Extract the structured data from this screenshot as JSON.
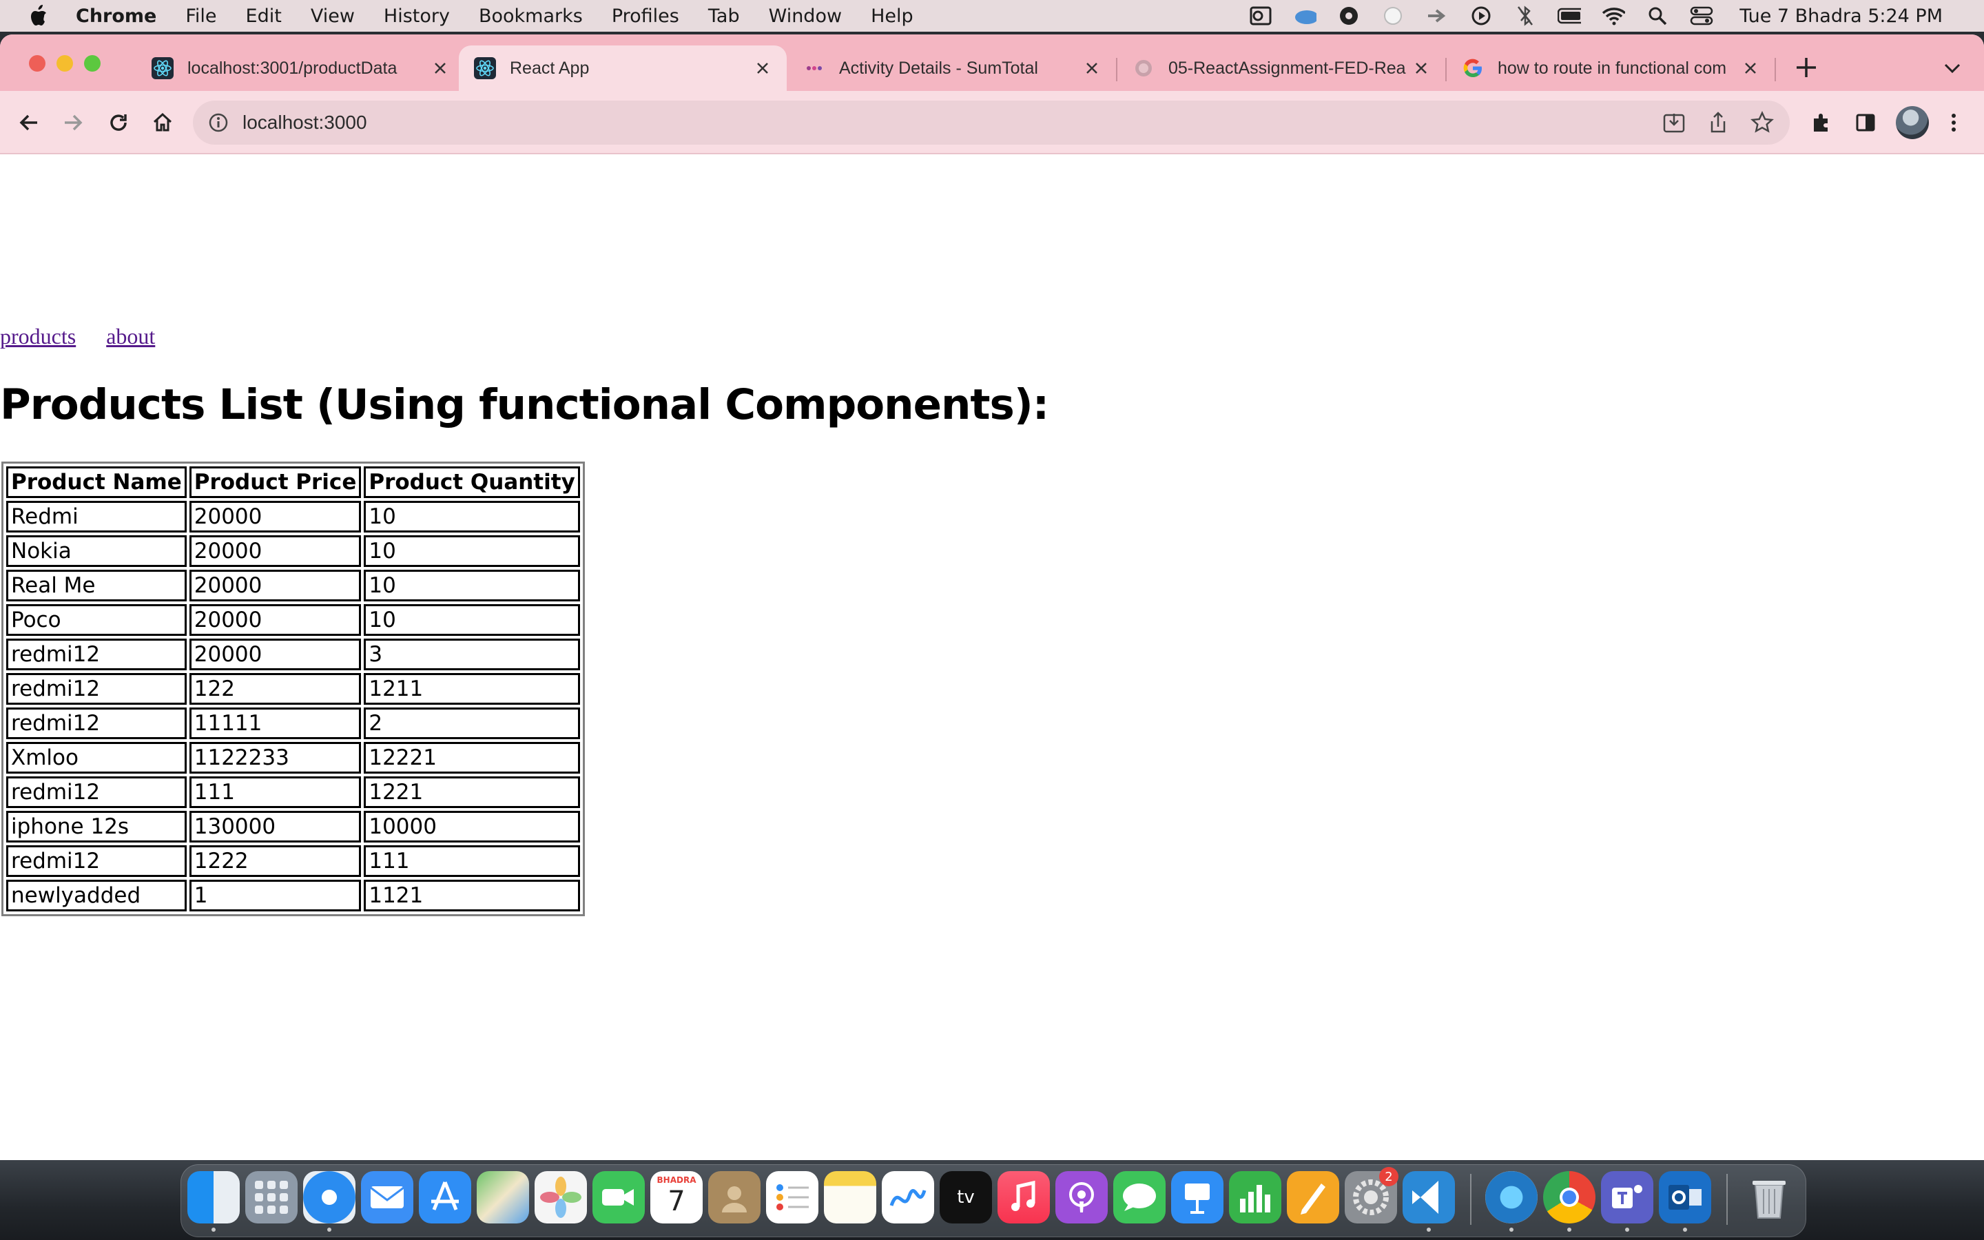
{
  "menubar": {
    "app_name": "Chrome",
    "menus": [
      "File",
      "Edit",
      "View",
      "History",
      "Bookmarks",
      "Profiles",
      "Tab",
      "Window",
      "Help"
    ],
    "clock": "Tue 7 Bhadra  5:24 PM"
  },
  "browser": {
    "tabs": [
      {
        "title": "localhost:3001/productData",
        "icon": "react-icon"
      },
      {
        "title": "React App",
        "icon": "react-icon",
        "active": true
      },
      {
        "title": "Activity Details - SumTotal",
        "icon": "wipro-icon"
      },
      {
        "title": "05-ReactAssignment-FED-Rea",
        "icon": "globe-icon"
      },
      {
        "title": "how to route in functional com",
        "icon": "google-icon"
      }
    ],
    "url": "localhost:3000"
  },
  "page": {
    "nav": {
      "products": "products",
      "about": "about"
    },
    "heading": "Products List (Using functional Components):",
    "table": {
      "headers": [
        "Product Name",
        "Product Price",
        "Product Quantity"
      ],
      "rows": [
        [
          "Redmi",
          "20000",
          "10"
        ],
        [
          "Nokia",
          "20000",
          "10"
        ],
        [
          "Real Me",
          "20000",
          "10"
        ],
        [
          "Poco",
          "20000",
          "10"
        ],
        [
          "redmi12",
          "20000",
          "3"
        ],
        [
          "redmi12",
          "122",
          "1211"
        ],
        [
          "redmi12",
          "11111",
          "2"
        ],
        [
          "Xmloo",
          "1122233",
          "12221"
        ],
        [
          "redmi12",
          "111",
          "1221"
        ],
        [
          "iphone 12s",
          "130000",
          "10000"
        ],
        [
          "redmi12",
          "1222",
          "111"
        ],
        [
          "newlyadded",
          "1",
          "1121"
        ]
      ]
    }
  },
  "dock": {
    "calendar": {
      "month": "BHADRA",
      "day": "7"
    },
    "settings_badge": "2",
    "tv_label": "tv"
  },
  "colors": {
    "tabstrip": "#f4b6c2",
    "toolbar": "#f9dde3",
    "link": "#551a8b"
  }
}
